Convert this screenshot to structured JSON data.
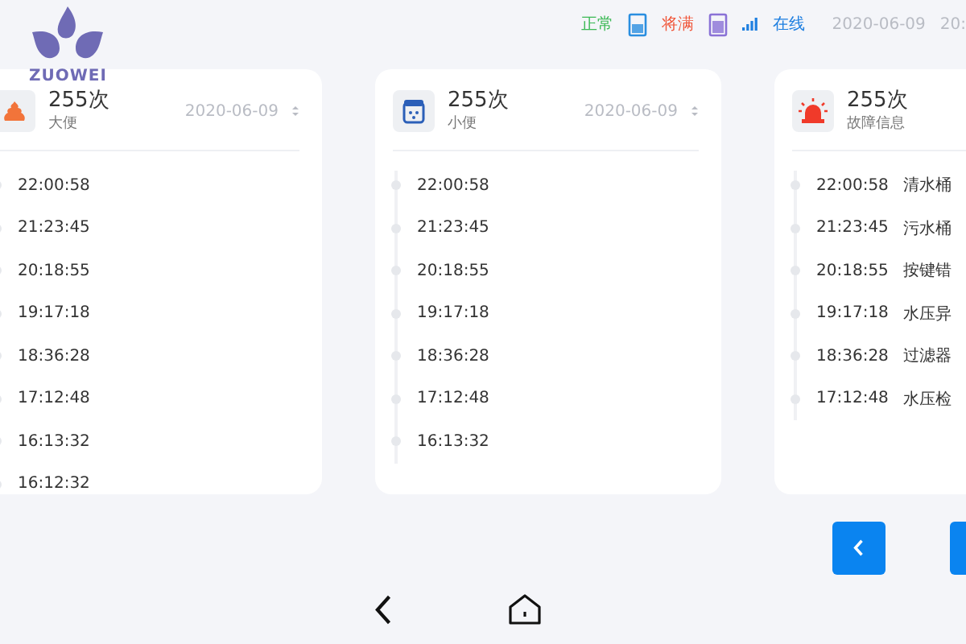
{
  "logo": {
    "text": "ZUOWEI"
  },
  "status_bar": {
    "indicators": [
      {
        "kind": "tank-clean",
        "label": "正常",
        "color": "#3dba57"
      },
      {
        "kind": "tank-dirty",
        "label": "将满",
        "color": "#f0563a"
      },
      {
        "kind": "signal",
        "label": "在线",
        "color": "#1e7fe0"
      }
    ],
    "date": "2020-06-09",
    "time": "20:"
  },
  "cards": [
    {
      "kind": "stool",
      "count": "255次",
      "label": "大便",
      "date": "2020-06-09",
      "events": [
        {
          "time": "22:00:58"
        },
        {
          "time": "21:23:45"
        },
        {
          "time": "20:18:55"
        },
        {
          "time": "19:17:18"
        },
        {
          "time": "18:36:28"
        },
        {
          "time": "17:12:48"
        },
        {
          "time": "16:13:32"
        },
        {
          "time": "16:12:32"
        }
      ]
    },
    {
      "kind": "urine",
      "count": "255次",
      "label": "小便",
      "date": "2020-06-09",
      "events": [
        {
          "time": "22:00:58"
        },
        {
          "time": "21:23:45"
        },
        {
          "time": "20:18:55"
        },
        {
          "time": "19:17:18"
        },
        {
          "time": "18:36:28"
        },
        {
          "time": "17:12:48"
        },
        {
          "time": "16:13:32"
        }
      ]
    },
    {
      "kind": "alarm",
      "count": "255次",
      "label": "故障信息",
      "events": [
        {
          "time": "22:00:58",
          "text": "清水桶"
        },
        {
          "time": "21:23:45",
          "text": "污水桶"
        },
        {
          "time": "20:18:55",
          "text": "按键错"
        },
        {
          "time": "19:17:18",
          "text": "水压异"
        },
        {
          "time": "18:36:28",
          "text": "过滤器"
        },
        {
          "time": "17:12:48",
          "text": "水压检"
        }
      ]
    }
  ],
  "pager": [
    {
      "kind": "prev"
    },
    {
      "kind": "next"
    }
  ],
  "nav": [
    {
      "kind": "back"
    },
    {
      "kind": "home"
    }
  ]
}
